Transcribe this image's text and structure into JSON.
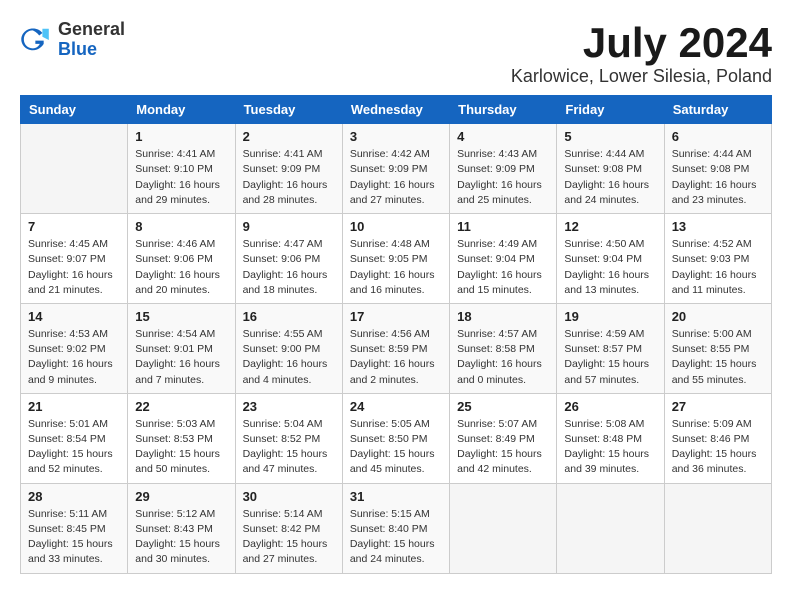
{
  "header": {
    "logo_general": "General",
    "logo_blue": "Blue",
    "month_title": "July 2024",
    "location": "Karlowice, Lower Silesia, Poland"
  },
  "days_of_week": [
    "Sunday",
    "Monday",
    "Tuesday",
    "Wednesday",
    "Thursday",
    "Friday",
    "Saturday"
  ],
  "weeks": [
    [
      {
        "day": "",
        "sunrise": "",
        "sunset": "",
        "daylight": ""
      },
      {
        "day": "1",
        "sunrise": "Sunrise: 4:41 AM",
        "sunset": "Sunset: 9:10 PM",
        "daylight": "Daylight: 16 hours and 29 minutes."
      },
      {
        "day": "2",
        "sunrise": "Sunrise: 4:41 AM",
        "sunset": "Sunset: 9:09 PM",
        "daylight": "Daylight: 16 hours and 28 minutes."
      },
      {
        "day": "3",
        "sunrise": "Sunrise: 4:42 AM",
        "sunset": "Sunset: 9:09 PM",
        "daylight": "Daylight: 16 hours and 27 minutes."
      },
      {
        "day": "4",
        "sunrise": "Sunrise: 4:43 AM",
        "sunset": "Sunset: 9:09 PM",
        "daylight": "Daylight: 16 hours and 25 minutes."
      },
      {
        "day": "5",
        "sunrise": "Sunrise: 4:44 AM",
        "sunset": "Sunset: 9:08 PM",
        "daylight": "Daylight: 16 hours and 24 minutes."
      },
      {
        "day": "6",
        "sunrise": "Sunrise: 4:44 AM",
        "sunset": "Sunset: 9:08 PM",
        "daylight": "Daylight: 16 hours and 23 minutes."
      }
    ],
    [
      {
        "day": "7",
        "sunrise": "Sunrise: 4:45 AM",
        "sunset": "Sunset: 9:07 PM",
        "daylight": "Daylight: 16 hours and 21 minutes."
      },
      {
        "day": "8",
        "sunrise": "Sunrise: 4:46 AM",
        "sunset": "Sunset: 9:06 PM",
        "daylight": "Daylight: 16 hours and 20 minutes."
      },
      {
        "day": "9",
        "sunrise": "Sunrise: 4:47 AM",
        "sunset": "Sunset: 9:06 PM",
        "daylight": "Daylight: 16 hours and 18 minutes."
      },
      {
        "day": "10",
        "sunrise": "Sunrise: 4:48 AM",
        "sunset": "Sunset: 9:05 PM",
        "daylight": "Daylight: 16 hours and 16 minutes."
      },
      {
        "day": "11",
        "sunrise": "Sunrise: 4:49 AM",
        "sunset": "Sunset: 9:04 PM",
        "daylight": "Daylight: 16 hours and 15 minutes."
      },
      {
        "day": "12",
        "sunrise": "Sunrise: 4:50 AM",
        "sunset": "Sunset: 9:04 PM",
        "daylight": "Daylight: 16 hours and 13 minutes."
      },
      {
        "day": "13",
        "sunrise": "Sunrise: 4:52 AM",
        "sunset": "Sunset: 9:03 PM",
        "daylight": "Daylight: 16 hours and 11 minutes."
      }
    ],
    [
      {
        "day": "14",
        "sunrise": "Sunrise: 4:53 AM",
        "sunset": "Sunset: 9:02 PM",
        "daylight": "Daylight: 16 hours and 9 minutes."
      },
      {
        "day": "15",
        "sunrise": "Sunrise: 4:54 AM",
        "sunset": "Sunset: 9:01 PM",
        "daylight": "Daylight: 16 hours and 7 minutes."
      },
      {
        "day": "16",
        "sunrise": "Sunrise: 4:55 AM",
        "sunset": "Sunset: 9:00 PM",
        "daylight": "Daylight: 16 hours and 4 minutes."
      },
      {
        "day": "17",
        "sunrise": "Sunrise: 4:56 AM",
        "sunset": "Sunset: 8:59 PM",
        "daylight": "Daylight: 16 hours and 2 minutes."
      },
      {
        "day": "18",
        "sunrise": "Sunrise: 4:57 AM",
        "sunset": "Sunset: 8:58 PM",
        "daylight": "Daylight: 16 hours and 0 minutes."
      },
      {
        "day": "19",
        "sunrise": "Sunrise: 4:59 AM",
        "sunset": "Sunset: 8:57 PM",
        "daylight": "Daylight: 15 hours and 57 minutes."
      },
      {
        "day": "20",
        "sunrise": "Sunrise: 5:00 AM",
        "sunset": "Sunset: 8:55 PM",
        "daylight": "Daylight: 15 hours and 55 minutes."
      }
    ],
    [
      {
        "day": "21",
        "sunrise": "Sunrise: 5:01 AM",
        "sunset": "Sunset: 8:54 PM",
        "daylight": "Daylight: 15 hours and 52 minutes."
      },
      {
        "day": "22",
        "sunrise": "Sunrise: 5:03 AM",
        "sunset": "Sunset: 8:53 PM",
        "daylight": "Daylight: 15 hours and 50 minutes."
      },
      {
        "day": "23",
        "sunrise": "Sunrise: 5:04 AM",
        "sunset": "Sunset: 8:52 PM",
        "daylight": "Daylight: 15 hours and 47 minutes."
      },
      {
        "day": "24",
        "sunrise": "Sunrise: 5:05 AM",
        "sunset": "Sunset: 8:50 PM",
        "daylight": "Daylight: 15 hours and 45 minutes."
      },
      {
        "day": "25",
        "sunrise": "Sunrise: 5:07 AM",
        "sunset": "Sunset: 8:49 PM",
        "daylight": "Daylight: 15 hours and 42 minutes."
      },
      {
        "day": "26",
        "sunrise": "Sunrise: 5:08 AM",
        "sunset": "Sunset: 8:48 PM",
        "daylight": "Daylight: 15 hours and 39 minutes."
      },
      {
        "day": "27",
        "sunrise": "Sunrise: 5:09 AM",
        "sunset": "Sunset: 8:46 PM",
        "daylight": "Daylight: 15 hours and 36 minutes."
      }
    ],
    [
      {
        "day": "28",
        "sunrise": "Sunrise: 5:11 AM",
        "sunset": "Sunset: 8:45 PM",
        "daylight": "Daylight: 15 hours and 33 minutes."
      },
      {
        "day": "29",
        "sunrise": "Sunrise: 5:12 AM",
        "sunset": "Sunset: 8:43 PM",
        "daylight": "Daylight: 15 hours and 30 minutes."
      },
      {
        "day": "30",
        "sunrise": "Sunrise: 5:14 AM",
        "sunset": "Sunset: 8:42 PM",
        "daylight": "Daylight: 15 hours and 27 minutes."
      },
      {
        "day": "31",
        "sunrise": "Sunrise: 5:15 AM",
        "sunset": "Sunset: 8:40 PM",
        "daylight": "Daylight: 15 hours and 24 minutes."
      },
      {
        "day": "",
        "sunrise": "",
        "sunset": "",
        "daylight": ""
      },
      {
        "day": "",
        "sunrise": "",
        "sunset": "",
        "daylight": ""
      },
      {
        "day": "",
        "sunrise": "",
        "sunset": "",
        "daylight": ""
      }
    ]
  ]
}
